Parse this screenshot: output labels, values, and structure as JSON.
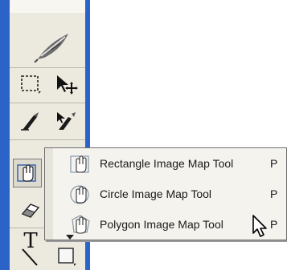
{
  "toolbox": {
    "tools": [
      {
        "name": "feather-brand-icon"
      },
      {
        "name": "marquee-tool-icon"
      },
      {
        "name": "move-tool-icon"
      },
      {
        "name": "slice-tool-icon"
      },
      {
        "name": "slice-select-tool-icon"
      },
      {
        "name": "rectangle-image-map-tool-icon"
      },
      {
        "name": "eraser-tool-icon"
      },
      {
        "name": "type-tool-icon"
      },
      {
        "name": "line-tool-icon"
      },
      {
        "name": "rectangle-shape-tool-icon"
      }
    ],
    "type_glyph": "T"
  },
  "flyout": {
    "items": [
      {
        "label": "Rectangle Image Map Tool",
        "shortcut": "P"
      },
      {
        "label": "Circle Image Map Tool",
        "shortcut": "P"
      },
      {
        "label": "Polygon Image Map Tool",
        "shortcut": "P"
      }
    ]
  },
  "colors": {
    "panel_frame": "#2c63c8",
    "toolbox_bg": "#ece9de",
    "flyout_bg": "#f4f3ee"
  }
}
